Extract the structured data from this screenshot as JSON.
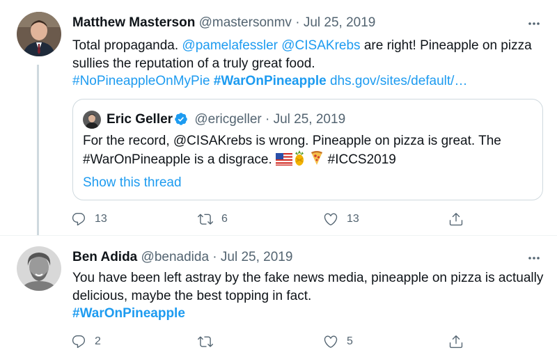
{
  "tweets": [
    {
      "author_name": "Matthew Masterson",
      "handle": "@mastersonmv",
      "separator": "·",
      "date": "Jul 25, 2019",
      "text_plain_1": "Total propaganda. ",
      "mention_1": "@pamelafessler",
      "text_space": " ",
      "mention_2": "@CISAKrebs",
      "text_plain_2": " are right! Pineapple on pizza sullies the reputation of a truly great food. ",
      "hashtag_1": "#NoPineappleOnMyPie",
      "hashtag_2": "#WarOnPineapple",
      "link": "dhs.gov/sites/default/…",
      "quote": {
        "author_name": "Eric Geller",
        "handle": "@ericgeller",
        "separator": "·",
        "date": "Jul 25, 2019",
        "text": "For the record, @CISAKrebs is wrong. Pineapple on pizza is great. The #WarOnPineapple is a disgrace.",
        "hashtag": "#ICCS2019",
        "emojis": [
          "us-flag-icon",
          "pineapple-icon",
          "pizza-icon"
        ],
        "show_thread": "Show this thread"
      },
      "replies": "13",
      "retweets": "6",
      "likes": "13"
    },
    {
      "author_name": "Ben Adida",
      "handle": "@benadida",
      "separator": "·",
      "date": "Jul 25, 2019",
      "text": "You have been left astray by the fake news media, pineapple on pizza is actually delicious, maybe the best topping in fact.",
      "hashtag": "#WarOnPineapple",
      "replies": "2",
      "retweets": "",
      "likes": "5"
    }
  ],
  "colors": {
    "accent": "#1d9bf0",
    "text": "#0f1419",
    "secondary": "#536471",
    "border": "#cfd9de"
  }
}
